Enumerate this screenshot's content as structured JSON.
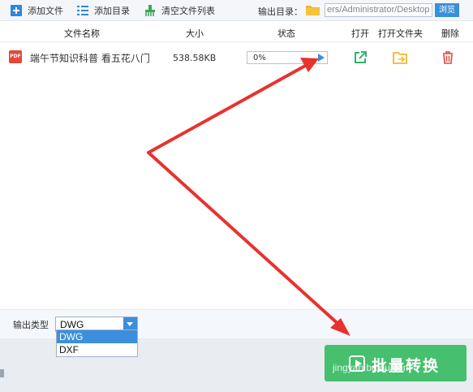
{
  "toolbar": {
    "add_file": "添加文件",
    "add_folder": "添加目录",
    "clear_list": "清空文件列表",
    "output_dir_label": "输出目录：",
    "output_dir_value": "ers/Administrator/Desktop",
    "browse": "浏览",
    "icons": {
      "add_file": "plus-icon",
      "add_folder": "list-icon",
      "clear_list": "broom-icon",
      "folder": "folder-icon"
    }
  },
  "table": {
    "headers": [
      "文件名称",
      "大小",
      "状态",
      "打开",
      "打开文件夹",
      "删除"
    ],
    "rows": [
      {
        "file_icon": "PDF",
        "name": "端午节知识科普  看五花八门",
        "size": "538.58KB",
        "progress": 0,
        "progress_text": "0%"
      }
    ]
  },
  "output_type": {
    "label": "输出类型",
    "selected": "DWG",
    "options": [
      "DWG",
      "DXF"
    ]
  },
  "convert_button": {
    "label": "批量转换"
  },
  "watermark": "jingyan.baidu.com",
  "colors": {
    "accent": "#3b8fdc",
    "convert_green": "#46bf6e",
    "open_green": "#2fb56a",
    "folder_yellow": "#f3b72b",
    "delete_red": "#e5453b",
    "arrow_red": "#e8322e"
  }
}
